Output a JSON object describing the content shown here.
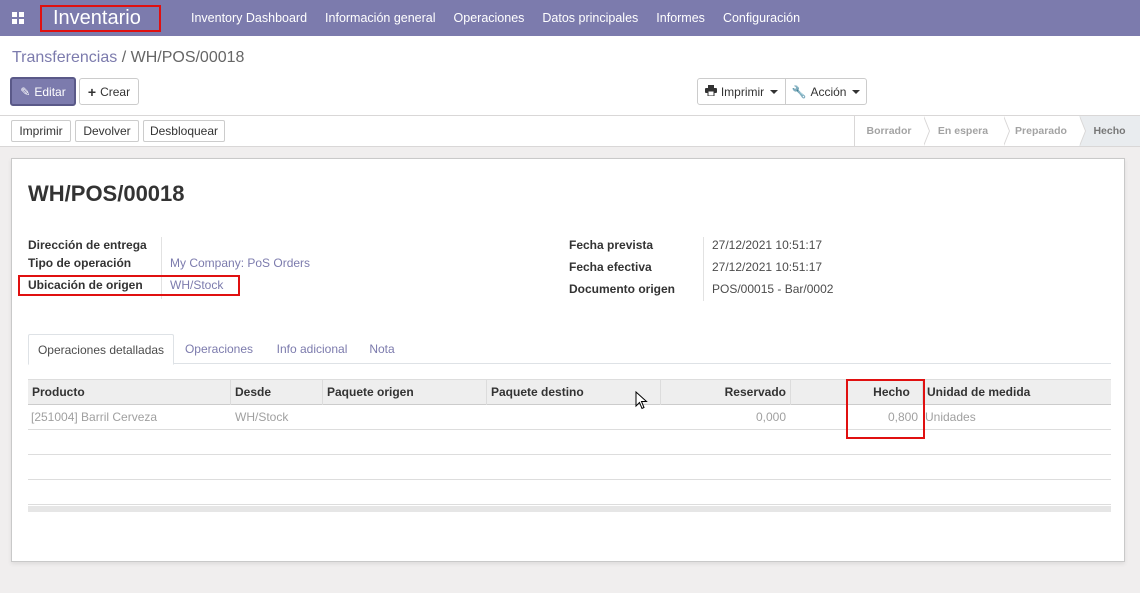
{
  "navbar": {
    "app_name": "Inventario",
    "menu": [
      "Inventory Dashboard",
      "Información general",
      "Operaciones",
      "Datos principales",
      "Informes",
      "Configuración"
    ]
  },
  "control_panel": {
    "breadcrumb_parent": "Transferencias",
    "breadcrumb_separator": "/",
    "breadcrumb_current": "WH/POS/00018",
    "edit_label": "Editar",
    "create_label": "Crear",
    "print_label": "Imprimir",
    "action_label": "Acción"
  },
  "statusbar": {
    "buttons": [
      "Imprimir",
      "Devolver",
      "Desbloquear"
    ],
    "stages": [
      "Borrador",
      "En espera",
      "Preparado",
      "Hecho"
    ],
    "active_stage": "Hecho"
  },
  "form": {
    "title": "WH/POS/00018",
    "left_fields": [
      {
        "label": "Dirección de entrega",
        "value": ""
      },
      {
        "label": "Tipo de operación",
        "value": "My Company: PoS Orders"
      },
      {
        "label": "Ubicación de origen",
        "value": "WH/Stock"
      }
    ],
    "right_fields": [
      {
        "label": "Fecha prevista",
        "value": "27/12/2021 10:51:17"
      },
      {
        "label": "Fecha efectiva",
        "value": "27/12/2021 10:51:17"
      },
      {
        "label": "Documento origen",
        "value": "POS/00015 - Bar/0002"
      }
    ],
    "tabs": [
      "Operaciones detalladas",
      "Operaciones",
      "Info adicional",
      "Nota"
    ],
    "active_tab": "Operaciones detalladas"
  },
  "table": {
    "columns": [
      "Producto",
      "Desde",
      "Paquete origen",
      "Paquete destino",
      "Reservado",
      "Hecho",
      "Unidad de medida"
    ],
    "rows": [
      {
        "producto": "[251004] Barril Cerveza",
        "desde": "WH/Stock",
        "paquete_origen": "",
        "paquete_destino": "",
        "reservado": "0,000",
        "hecho": "0,800",
        "unidad": "Unidades"
      }
    ]
  },
  "colors": {
    "brand": "#7c7bad",
    "highlight": "#e01010"
  }
}
